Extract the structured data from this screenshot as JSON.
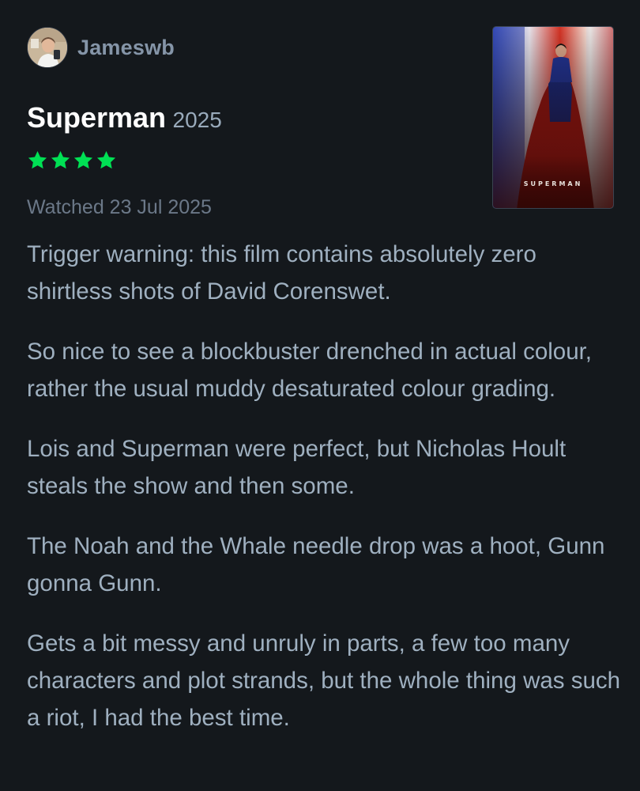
{
  "reviewer": {
    "username": "Jameswb",
    "avatar_icon": "user-avatar-photo"
  },
  "film": {
    "title": "Superman",
    "year": "2025",
    "poster_text": "SUPERMAN",
    "rating_stars": 4,
    "star_color": "#00e054"
  },
  "watched": "Watched 23 Jul 2025",
  "review": {
    "paragraphs": [
      "Trigger warning: this film contains absolutely zero shirtless shots of David Corenswet.",
      "So nice to see a blockbuster drenched in actual colour, rather the usual muddy desaturated colour grading.",
      "Lois and Superman were perfect, but Nicholas Hoult steals the show and then some.",
      "The Noah and the Whale needle drop was a hoot, Gunn gonna Gunn.",
      "Gets a bit messy and unruly in parts, a few too many characters and plot strands, but the whole thing was such a riot, I had the best time."
    ]
  },
  "colors": {
    "background": "#14181c",
    "title": "#ffffff",
    "body_text": "#9fb0c0",
    "muted_text": "#6b7888",
    "accent_green": "#00e054"
  }
}
